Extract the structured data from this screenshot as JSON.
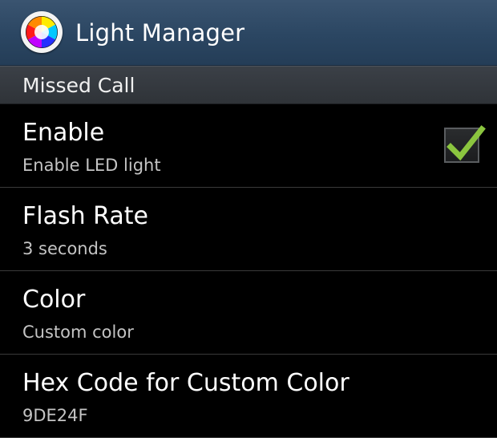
{
  "app": {
    "title": "Light Manager",
    "icon": "rgb-color-wheel-icon"
  },
  "category": {
    "title": "Missed Call"
  },
  "preferences": [
    {
      "title": "Enable",
      "summary": "Enable LED light",
      "checked": true
    },
    {
      "title": "Flash Rate",
      "summary": "3 seconds"
    },
    {
      "title": "Color",
      "summary": "Custom color"
    },
    {
      "title": "Hex Code for Custom Color",
      "summary": "9DE24F"
    }
  ],
  "colors": {
    "action_bar": "#2b4662",
    "category_bar": "#33373c",
    "background": "#000000",
    "checkmark": "#8bc53f",
    "summary_text": "#c4c4c4"
  }
}
